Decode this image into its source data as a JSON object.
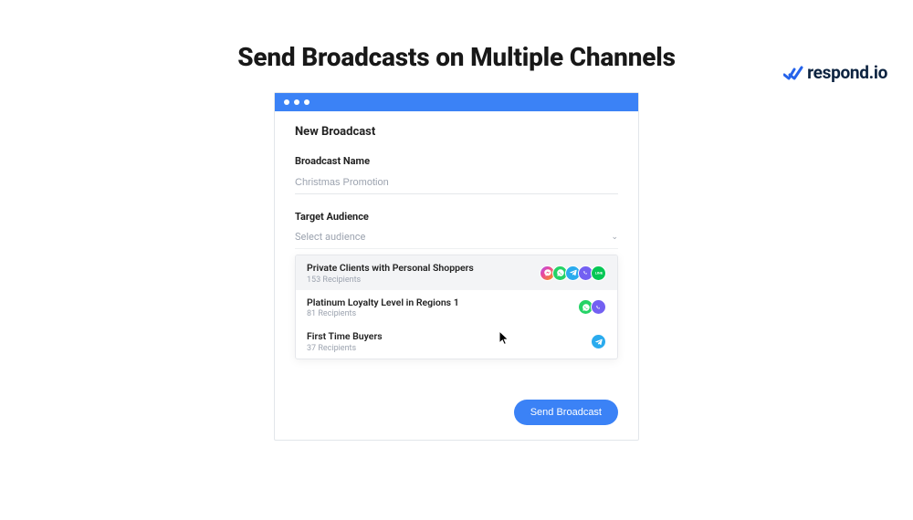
{
  "brand": {
    "name": "respond.io"
  },
  "headline": "Send Broadcasts on Multiple Channels",
  "modal": {
    "title": "New Broadcast",
    "name_label": "Broadcast Name",
    "name_value": "Christmas Promotion",
    "audience_label": "Target Audience",
    "audience_placeholder": "Select audience",
    "options": [
      {
        "title": "Private Clients with Personal Shoppers",
        "subtitle": "153 Recipients",
        "channels": [
          "messenger",
          "whatsapp",
          "telegram",
          "viber",
          "line"
        ],
        "hovered": true
      },
      {
        "title": "Platinum Loyalty Level in Regions 1",
        "subtitle": "81 Recipients",
        "channels": [
          "whatsapp",
          "viber"
        ],
        "hovered": false
      },
      {
        "title": "First Time Buyers",
        "subtitle": "37 Recipients",
        "channels": [
          "telegram"
        ],
        "hovered": false
      }
    ],
    "cta": "Send Broadcast"
  },
  "icons": {
    "messenger": "messenger-icon",
    "whatsapp": "whatsapp-icon",
    "telegram": "telegram-icon",
    "viber": "viber-icon",
    "line": "line-icon"
  }
}
